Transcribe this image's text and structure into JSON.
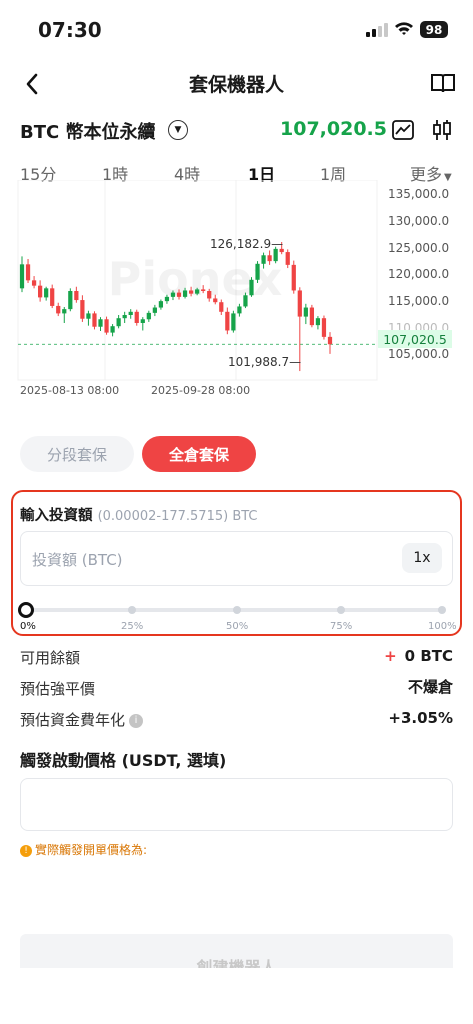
{
  "status_bar": {
    "time": "07:30",
    "battery": "98"
  },
  "nav": {
    "title": "套保機器人"
  },
  "ticker": {
    "symbol": "BTC 幣本位永續",
    "price": "107,020.5"
  },
  "timeframes": [
    {
      "label": "15分",
      "active": false
    },
    {
      "label": "1時",
      "active": false
    },
    {
      "label": "4時",
      "active": false
    },
    {
      "label": "1日",
      "active": true
    },
    {
      "label": "1周",
      "active": false
    },
    {
      "label": "更多",
      "active": false
    }
  ],
  "chart_data": {
    "type": "candlestick",
    "y_axis_ticks": [
      "135,000.0",
      "130,000.0",
      "125,000.0",
      "120,000.0",
      "115,000.0",
      "110,000.0",
      "105,000.0"
    ],
    "ylim": [
      103000,
      137000
    ],
    "x_axis_ticks": [
      "2025-08-13 08:00",
      "2025-09-28 08:00"
    ],
    "annotations": {
      "high": "126,182.9",
      "low": "101,988.7"
    },
    "current_price": "107,020.5",
    "watermark": "Pionex",
    "candles": [
      [
        117500,
        123500,
        116800,
        122000
      ],
      [
        122000,
        123000,
        118500,
        119000
      ],
      [
        119000,
        119800,
        117500,
        118000
      ],
      [
        118000,
        119000,
        115000,
        115800
      ],
      [
        115800,
        117800,
        115200,
        117500
      ],
      [
        117500,
        118200,
        113800,
        114200
      ],
      [
        114200,
        114800,
        112300,
        112800
      ],
      [
        112800,
        114000,
        111000,
        113600
      ],
      [
        113600,
        117500,
        113200,
        117000
      ],
      [
        117000,
        117800,
        114800,
        115300
      ],
      [
        115300,
        116200,
        111200,
        111800
      ],
      [
        111800,
        113300,
        110500,
        112800
      ],
      [
        112800,
        113200,
        109800,
        110300
      ],
      [
        110300,
        112100,
        109500,
        111700
      ],
      [
        111700,
        112200,
        108800,
        109200
      ],
      [
        109200,
        110800,
        108500,
        110400
      ],
      [
        110400,
        112500,
        110000,
        111900
      ],
      [
        111900,
        113100,
        111000,
        112500
      ],
      [
        112500,
        113600,
        111800,
        113100
      ],
      [
        113100,
        113500,
        110500,
        111000
      ],
      [
        111000,
        112100,
        109600,
        111700
      ],
      [
        111700,
        113300,
        111200,
        112900
      ],
      [
        112900,
        114400,
        112300,
        113900
      ],
      [
        113900,
        115400,
        113500,
        115100
      ],
      [
        115100,
        116300,
        114600,
        115900
      ],
      [
        115900,
        117100,
        115300,
        116700
      ],
      [
        116700,
        117300,
        115400,
        115900
      ],
      [
        115900,
        117600,
        115600,
        117100
      ],
      [
        117100,
        117800,
        116000,
        116500
      ],
      [
        116500,
        117600,
        116200,
        117300
      ],
      [
        117300,
        118100,
        116600,
        117000
      ],
      [
        117000,
        117400,
        115000,
        115600
      ],
      [
        115600,
        116300,
        114500,
        114900
      ],
      [
        114900,
        115400,
        112500,
        113100
      ],
      [
        113100,
        113900,
        108900,
        109600
      ],
      [
        109600,
        113300,
        109200,
        112800
      ],
      [
        112800,
        114600,
        112200,
        114100
      ],
      [
        114100,
        116700,
        113800,
        116200
      ],
      [
        116200,
        119600,
        115900,
        119100
      ],
      [
        119100,
        122600,
        118500,
        122100
      ],
      [
        122100,
        124200,
        121200,
        123700
      ],
      [
        123700,
        124600,
        121900,
        122600
      ],
      [
        122600,
        125300,
        122200,
        124900
      ],
      [
        124900,
        126182.9,
        123900,
        124300
      ],
      [
        124300,
        124800,
        121300,
        121900
      ],
      [
        121900,
        122700,
        116500,
        117100
      ],
      [
        117100,
        117700,
        101988.7,
        112200
      ],
      [
        112200,
        114600,
        110800,
        113900
      ],
      [
        113900,
        114400,
        110200,
        110600
      ],
      [
        110600,
        112300,
        109800,
        111900
      ],
      [
        111900,
        112400,
        107900,
        108400
      ],
      [
        108400,
        109300,
        105200,
        107020.5
      ]
    ]
  },
  "modes": {
    "partial": "分段套保",
    "full": "全倉套保"
  },
  "invest": {
    "label": "輸入投資額",
    "range": "(0.00002-177.5715) BTC",
    "placeholder": "投資額 (BTC)",
    "leverage": "1x",
    "percents": [
      "0%",
      "25%",
      "50%",
      "75%",
      "100%"
    ],
    "slider_value": 0
  },
  "info": [
    {
      "label": "可用餘額",
      "value": "0 BTC"
    },
    {
      "label": "預估強平價",
      "value": "不爆倉"
    },
    {
      "label": "預估資金費年化",
      "value": "+3.05%"
    }
  ],
  "trigger": {
    "label": "觸發啟動價格 (USDT, 選填)",
    "hint": "實際觸發開單價格為:"
  },
  "create_button": "創建機器人",
  "colors": {
    "up": "#16a34a",
    "down": "#ef4444",
    "accent": "#ef4444"
  }
}
